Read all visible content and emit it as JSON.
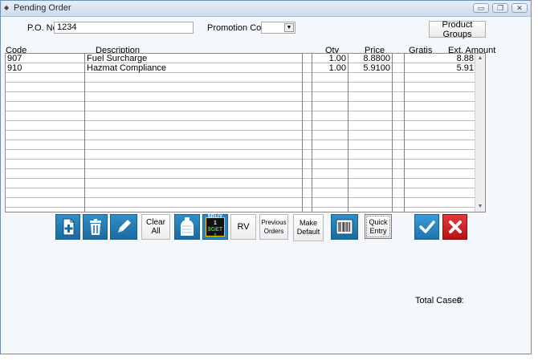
{
  "window": {
    "title": "Pending Order",
    "minimize_glyph": "▭",
    "restore_glyph": "❐",
    "close_glyph": "✕"
  },
  "form": {
    "po_label": "P.O. No.",
    "po_value": "1234",
    "promo_label": "Promotion Code.",
    "promo_value": "",
    "product_groups_label": "Product Groups"
  },
  "grid": {
    "columns": [
      "Code",
      "Description",
      "Qty",
      "Price",
      "Gratis",
      "Ext. Amount"
    ],
    "rows": [
      {
        "code": "907",
        "description": "Fuel Surcharge",
        "qty": "1.00",
        "price": "8.8800",
        "gratis": "",
        "ext": "8.88"
      },
      {
        "code": "910",
        "description": "Hazmat Compliance",
        "qty": "1.00",
        "price": "5.9100",
        "gratis": "",
        "ext": "5.91"
      }
    ]
  },
  "toolbar": {
    "new_icon": "add-document-icon",
    "delete_icon": "trash-icon",
    "edit_icon": "pencil-icon",
    "clear_all": "Clear All",
    "bottle_icon": "water-bottle-icon",
    "promo_icon_line1": "$BUY 1",
    "promo_icon_line2": "$GET 1",
    "rv": "RV",
    "previous_orders": "Previous Orders",
    "make_default": "Make Default",
    "barcode_icon": "barcode-icon",
    "quick_entry": "Quick Entry",
    "ok_icon": "checkmark-icon",
    "cancel_icon": "close-x-icon"
  },
  "footer": {
    "total_cases_label": "Total Cases:",
    "total_cases_value": "0"
  },
  "colors": {
    "accent_blue": "#1a6aa0",
    "cancel_red": "#c21a1a"
  }
}
